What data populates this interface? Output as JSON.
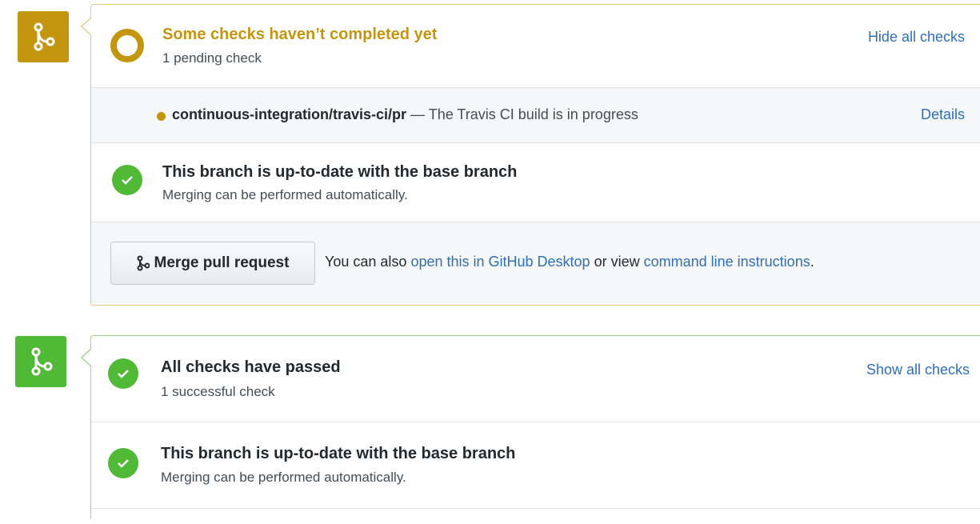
{
  "pending_panel": {
    "icon": "git-merge-icon",
    "color": "#c4960f",
    "title": "Some checks haven’t completed yet",
    "subtitle": "1 pending check",
    "toggle_link": "Hide all checks",
    "check": {
      "name": "continuous-integration/travis-ci/pr",
      "separator": "—",
      "description": "The Travis CI build is in progress",
      "details_link": "Details",
      "status_color": "#c4960f"
    },
    "branch_status": {
      "title": "This branch is up-to-date with the base branch",
      "subtitle": "Merging can be performed automatically."
    },
    "merge": {
      "button_label": "Merge pull request",
      "help_prefix": "You can also",
      "desktop_link": "open this in GitHub Desktop",
      "help_middle": "or view",
      "cli_link": "command line instructions",
      "help_suffix": "."
    }
  },
  "success_panel": {
    "icon": "git-merge-icon",
    "color": "#50b935",
    "title": "All checks have passed",
    "subtitle": "1 successful check",
    "toggle_link": "Show all checks",
    "branch_status": {
      "title": "This branch is up-to-date with the base branch",
      "subtitle": "Merging can be performed automatically."
    }
  }
}
